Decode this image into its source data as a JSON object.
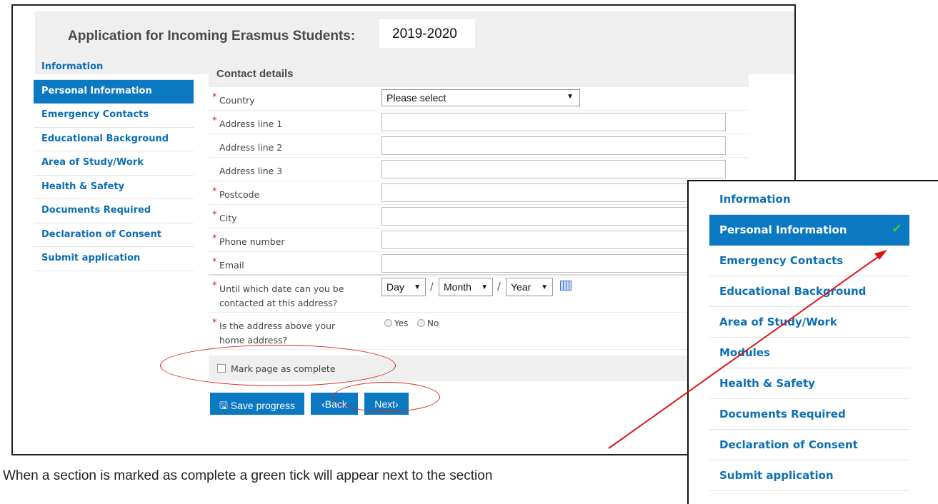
{
  "header": {
    "title": "Application for Incoming Erasmus Students: ",
    "year": "2019-2020"
  },
  "leftnav": {
    "items": [
      {
        "label": "Information"
      },
      {
        "label": "Personal Information"
      },
      {
        "label": "Emergency Contacts"
      },
      {
        "label": "Educational Background"
      },
      {
        "label": "Area of Study/Work"
      },
      {
        "label": "Health & Safety"
      },
      {
        "label": "Documents Required"
      },
      {
        "label": "Declaration of Consent"
      },
      {
        "label": "Submit application"
      }
    ],
    "active_index": 1
  },
  "form": {
    "section_title": "Contact details",
    "country": {
      "label": "Country",
      "value": "Please select"
    },
    "address1": {
      "label": "Address line 1",
      "value": ""
    },
    "address2": {
      "label": "Address line 2",
      "value": ""
    },
    "address3": {
      "label": "Address line 3",
      "value": ""
    },
    "postcode": {
      "label": "Postcode",
      "value": ""
    },
    "city": {
      "label": "City",
      "value": ""
    },
    "phone": {
      "label": "Phone number",
      "value": ""
    },
    "email": {
      "label": "Email",
      "value": ""
    },
    "contact_until": {
      "label": "Until which date can you be contacted at this address?",
      "day": "Day",
      "month": "Month",
      "year": "Year",
      "separator": "/"
    },
    "home_address": {
      "label": "Is the address above your home address?",
      "yes": "Yes",
      "no": "No"
    },
    "required_mark": "*",
    "mark_complete": "Mark page as complete",
    "buttons": {
      "save": "Save progress",
      "back": "Back",
      "next": "Next"
    }
  },
  "zoom_nav": {
    "items": [
      {
        "label": "Information"
      },
      {
        "label": "Personal Information"
      },
      {
        "label": "Emergency Contacts"
      },
      {
        "label": "Educational Background"
      },
      {
        "label": "Area of Study/Work"
      },
      {
        "label": "Modules"
      },
      {
        "label": "Health & Safety"
      },
      {
        "label": "Documents Required"
      },
      {
        "label": "Declaration of Consent"
      },
      {
        "label": "Submit application"
      }
    ],
    "completed_index": 1,
    "tick": "✔"
  },
  "caption": "When a section is marked as complete a green tick will appear next to the section",
  "colors": {
    "accent": "#0b78c2",
    "annotation": "#d9261c",
    "tick": "#3cc23c"
  },
  "icons": {
    "save": "save-icon",
    "back": "chevron-left-icon",
    "next": "chevron-right-icon",
    "dropdown": "caret-down-icon",
    "calendar": "calendar-icon",
    "tick": "check-icon"
  }
}
